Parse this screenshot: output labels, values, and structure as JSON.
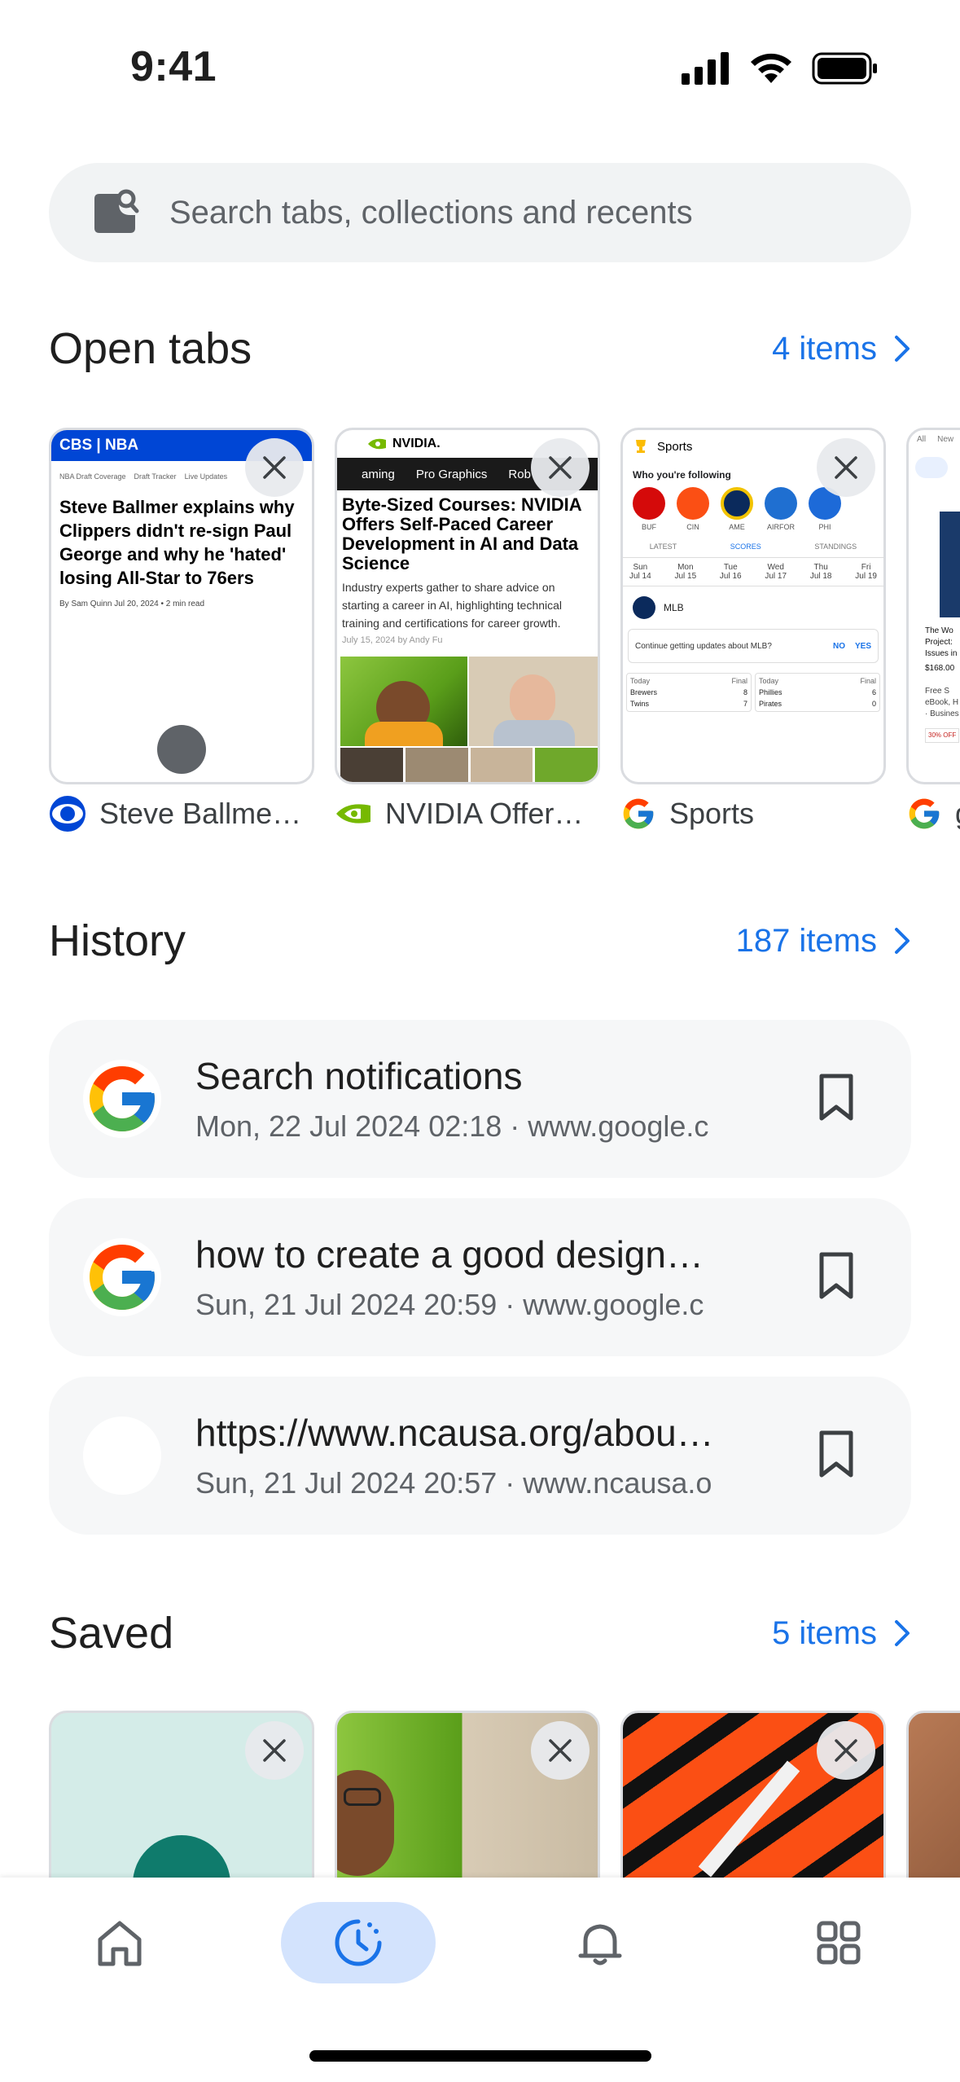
{
  "status_bar": {
    "time": "9:41"
  },
  "search": {
    "placeholder": "Search tabs, collections and recents"
  },
  "open_tabs": {
    "title": "Open tabs",
    "count_label": "4 items",
    "tabs": [
      {
        "label": "Steve Ballme…",
        "favicon": "cbs-eye-icon",
        "thumb": {
          "header": "CBS | NBA",
          "nav": [
            "NBA Draft Coverage",
            "Draft Tracker",
            "Live Updates"
          ],
          "headline": "Steve Ballmer explains why Clippers didn't re-sign Paul George and why he 'hated' losing All-Star to 76ers",
          "byline": "By Sam Quinn Jul 20, 2024 • 2 min read"
        }
      },
      {
        "label": "NVIDIA Offer…",
        "favicon": "nvidia-icon",
        "thumb": {
          "brand": "NVIDIA.",
          "nav": [
            "aming",
            "Pro Graphics",
            "Rob"
          ],
          "headline": "Byte-Sized Courses: NVIDIA Offers Self-Paced Career Development in AI and Data Science",
          "body": "Industry experts gather to share advice on starting a career in AI, highlighting technical training and certifications for career growth.",
          "date": "July 15, 2024 by Andy Fu"
        }
      },
      {
        "label": "Sports",
        "favicon": "google-icon",
        "thumb": {
          "title": "Sports",
          "following": "Who you're following",
          "teams": [
            "BUF",
            "CIN",
            "AME",
            "AIRFOR",
            "PHI"
          ],
          "tabs": [
            "LATEST",
            "SCORES",
            "STANDINGS"
          ],
          "days": [
            {
              "d": "Sun",
              "n": "Jul 14"
            },
            {
              "d": "Mon",
              "n": "Jul 15"
            },
            {
              "d": "Tue",
              "n": "Jul 16"
            },
            {
              "d": "Wed",
              "n": "Jul 17"
            },
            {
              "d": "Thu",
              "n": "Jul 18"
            },
            {
              "d": "Fri",
              "n": "Jul 19"
            }
          ],
          "league": "MLB",
          "prompt": "Continue getting updates about MLB?",
          "no": "NO",
          "yes": "YES",
          "game1": {
            "when": "Today",
            "status": "Final",
            "t1": "Brewers",
            "s1": "8",
            "t2": "Twins",
            "s2": "7"
          },
          "game2": {
            "when": "Today",
            "status": "Final",
            "t1": "Phillies",
            "s1": "6",
            "t2": "Pirates",
            "s2": "0"
          }
        }
      },
      {
        "label": "g",
        "favicon": "google-icon",
        "thumb": {
          "tabs": [
            "All",
            "New"
          ],
          "text1": "The Wo",
          "text2": "Project:",
          "text3": "Issues in",
          "price": "$168.00",
          "text4": "Free S",
          "text5": "eBook, H",
          "text6": "· Busines",
          "badge": "30% OFF"
        }
      }
    ]
  },
  "history": {
    "title": "History",
    "count_label": "187 items",
    "items": [
      {
        "title": "Search notifications",
        "subtitle": "Mon, 22 Jul 2024 02:18 · www.google.c",
        "favicon": "google-icon"
      },
      {
        "title": "how to create a good design…",
        "subtitle": "Sun, 21 Jul 2024 20:59 · www.google.c",
        "favicon": "google-icon"
      },
      {
        "title": "https://www.ncausa.org/abou…",
        "subtitle": "Sun, 21 Jul 2024 20:57 · www.ncausa.o",
        "favicon": "blank-icon"
      }
    ]
  },
  "saved": {
    "title": "Saved",
    "count_label": "5 items"
  },
  "bottom_nav": {
    "items": [
      "home-icon",
      "history-icon",
      "bell-icon",
      "grid-icon"
    ],
    "active": "history-icon"
  },
  "colors": {
    "accent": "#1a73e8",
    "active_pill": "#d3e3fd",
    "card_bg": "#f6f7f8"
  }
}
